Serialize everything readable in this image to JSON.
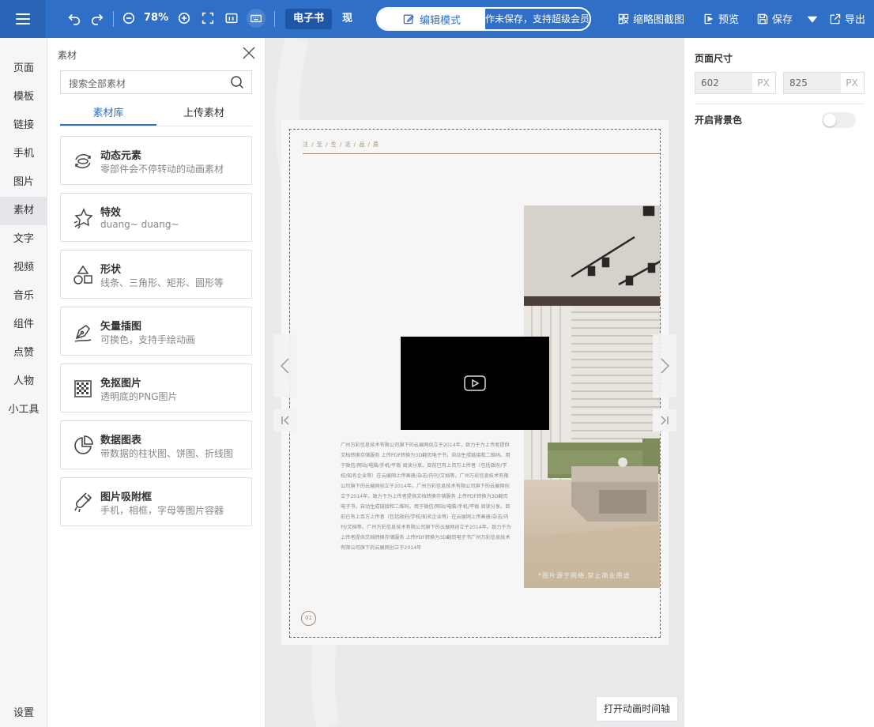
{
  "toolbar": {
    "zoom": "78%",
    "tabs": [
      "电子书",
      "现"
    ],
    "mode_label": "编辑模式",
    "mode_right_text": "作未保存，支持超级会员",
    "actions": {
      "thumbnail": "缩略图截图",
      "preview": "预览",
      "save": "保存",
      "export": "导出"
    }
  },
  "leftnav": {
    "items": [
      "页面",
      "模板",
      "链接",
      "手机",
      "图片",
      "素材",
      "文字",
      "视频",
      "音乐",
      "组件",
      "点赞",
      "人物",
      "小工具"
    ],
    "settings": "设置"
  },
  "panel": {
    "title": "素材",
    "search_placeholder": "搜索全部素材",
    "tabs": [
      "素材库",
      "上传素材"
    ],
    "cards": [
      {
        "title": "动态元素",
        "desc": "零部件会不停转动的动画素材",
        "icon": "rotate-arrows-icon"
      },
      {
        "title": "特效",
        "desc": "duang~ duang~",
        "icon": "sparkle-star-icon"
      },
      {
        "title": "形状",
        "desc": "线条、三角形、矩形、圆形等",
        "icon": "shapes-icon"
      },
      {
        "title": "矢量插图",
        "desc": "可换色，支持手绘动画",
        "icon": "pen-nib-icon"
      },
      {
        "title": "免抠图片",
        "desc": "透明底的PNG图片",
        "icon": "checkerboard-icon"
      },
      {
        "title": "数据图表",
        "desc": "带数据的柱状图、饼图、折线图",
        "icon": "pie-chart-icon"
      },
      {
        "title": "图片吸附框",
        "desc": "手机，相框，字母等图片容器",
        "icon": "magnet-icon"
      }
    ]
  },
  "canvas": {
    "page_header": "注 / 至 / 生 / 活 / 品 / 质",
    "photo_caption": "*图片源于网络,禁止商业用途",
    "body_text": "广州万彩信息技术有限公司旗下的云展网创立于2014年，致力于为上传者提供文档转换存储服务 上传PDF转换为3D翻页电子书，自动生成链接和二维码。用于微信/网站/电脑/手机/平板 阅读分享。目前已有上百万上传者（包括政府/学校/知名企业等）在云展网上传画册/杂志/内刊/文档等。广州万彩信息技术有限公司旗下的云展网创立于2014年。广州万彩信息技术有限公司旗下的云展网创立于2014年，致力于为上传者提供文档转换存储服务 上传PDF转换为3D翻页电子书，自动生成链接和二维码。用于微信/网站/电脑/手机/平板 阅读分享。目前已有上百万上传者（包括政府/学校/知名企业等）在云展网上传画册/杂志/内刊/文档等。广州万彩信息技术有限公司旗下的云展网创立于2014年。致力于为上传者提供文档转换存储服务 上传PDF转换为3D翻页电子书广州万彩信息技术有限公司旗下的云展网创立于2014年",
    "page_number": "01",
    "timeline_button": "打开动画时间轴"
  },
  "props": {
    "page_size_label": "页面尺寸",
    "width": "602",
    "height": "825",
    "unit": "PX",
    "bg_color_label": "开启背景色",
    "bg_color_enabled": false
  },
  "colors": {
    "primary": "#2f6fc7",
    "accent_gold": "#a58a6a"
  }
}
